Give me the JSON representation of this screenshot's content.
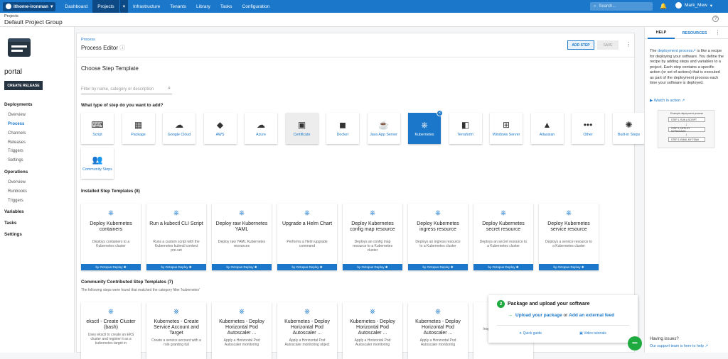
{
  "topbar": {
    "space": "ithome-ironman",
    "nav": [
      "Dashboard",
      "Projects",
      "Infrastructure",
      "Tenants",
      "Library",
      "Tasks",
      "Configuration"
    ],
    "search_placeholder": "Search...",
    "user": "Mark_Mew"
  },
  "header": {
    "breadcrumb": "Projects",
    "title": "Default Project Group"
  },
  "sidebar": {
    "project": "portal",
    "create_release": "CREATE RELEASE",
    "deployments": "Deployments",
    "dep_items": [
      "Overview",
      "Process",
      "Channels",
      "Releases",
      "Triggers",
      "Settings"
    ],
    "operations": "Operations",
    "op_items": [
      "Overview",
      "Runbooks",
      "Triggers"
    ],
    "variables": "Variables",
    "tasks": "Tasks",
    "settings": "Settings"
  },
  "editor": {
    "link": "Process",
    "title": "Process Editor",
    "add_step": "ADD STEP",
    "save": "SAVE",
    "choose": "Choose Step Template",
    "filter_placeholder": "Filter by name, category or description",
    "what_type": "What type of step do you want to add?",
    "types": [
      {
        "label": "Script",
        "icon": "script-icon",
        "glyph": "⌨"
      },
      {
        "label": "Package",
        "icon": "package-icon",
        "glyph": "▦"
      },
      {
        "label": "Google Cloud",
        "icon": "google-cloud-icon",
        "glyph": "☁"
      },
      {
        "label": "AWS",
        "icon": "aws-icon",
        "glyph": "◆"
      },
      {
        "label": "Azure",
        "icon": "azure-icon",
        "glyph": "☁"
      },
      {
        "label": "Certificate",
        "icon": "certificate-icon",
        "glyph": "▣"
      },
      {
        "label": "Docker",
        "icon": "docker-icon",
        "glyph": "◼"
      },
      {
        "label": "Java App Server",
        "icon": "java-icon",
        "glyph": "☕"
      },
      {
        "label": "Kubernetes",
        "icon": "kubernetes-icon",
        "glyph": "⎈"
      },
      {
        "label": "Terraform",
        "icon": "terraform-icon",
        "glyph": "◧"
      },
      {
        "label": "Windows Server",
        "icon": "windows-icon",
        "glyph": "⊞"
      },
      {
        "label": "Atlassian",
        "icon": "atlassian-icon",
        "glyph": "▲"
      },
      {
        "label": "Other",
        "icon": "other-icon",
        "glyph": "•••"
      },
      {
        "label": "Built-in Steps",
        "icon": "octopus-icon",
        "glyph": "✺"
      },
      {
        "label": "Community Steps",
        "icon": "community-icon",
        "glyph": "👥"
      }
    ],
    "installed_title": "Installed Step Templates (8)",
    "installed": [
      {
        "title": "Deploy Kubernetes containers",
        "desc": "Deploys containers to a Kubernetes cluster",
        "by": "by Octopus Deploy"
      },
      {
        "title": "Run a kubectl CLI Script",
        "desc": "Runs a custom script with the Kubernetes kubectl context pre-set",
        "by": "by Octopus Deploy"
      },
      {
        "title": "Deploy raw Kubernetes YAML",
        "desc": "Deploy raw YAML Kubernetes resources",
        "by": "by Octopus Deploy"
      },
      {
        "title": "Upgrade a Helm Chart",
        "desc": "Performs a Helm upgrade command",
        "by": "by Octopus Deploy"
      },
      {
        "title": "Deploy Kubernetes config map resource",
        "desc": "Deploys an config map resource to a Kubernetes cluster",
        "by": "by Octopus Deploy"
      },
      {
        "title": "Deploy Kubernetes ingress resource",
        "desc": "Deploys an ingress resource to a Kubernetes cluster",
        "by": "by Octopus Deploy"
      },
      {
        "title": "Deploy Kubernetes secret resource",
        "desc": "Deploys an secret resource to a Kubernetes cluster",
        "by": "by Octopus Deploy"
      },
      {
        "title": "Deploy Kubernetes service resource",
        "desc": "Deploys a service resource to a Kubernetes cluster",
        "by": "by Octopus Deploy"
      }
    ],
    "community_title": "Community Contributed Step Templates (7)",
    "community_sub": "The following steps were found that matched the category filter 'kubernetes'",
    "community": [
      {
        "title": "eksctl - Create Cluster (bash)",
        "desc": "Uses eksctl to create an EKS cluster and register it as a kubernetes target in"
      },
      {
        "title": "Kubernetes - Create Service Account and Target",
        "desc": "Create a service account with a role granting full"
      },
      {
        "title": "Kubernetes - Deploy Horizontal Pod Autoscaler ...",
        "desc": "Apply a Horizontal Pod Autoscaler monitoring"
      },
      {
        "title": "Kubernetes - Deploy Horizontal Pod Autoscaler ...",
        "desc": "Apply a Horizontal Pod Autoscaler monitoring object"
      },
      {
        "title": "Kubernetes - Deploy Horizontal Pod Autoscaler ...",
        "desc": "Apply a Horizontal Pod Autoscaler monitoring"
      },
      {
        "title": "Kubernetes - Deploy Horizontal Pod Autoscaler ...",
        "desc": "Apply a Horizontal Pod Autoscaler monitoring"
      },
      {
        "title": "Kube",
        "desc": "Inspe... describe and edit. Optionally"
      }
    ]
  },
  "popup": {
    "step": "2",
    "title": "Package and upload your software",
    "upload": "Upload your package",
    "or": " or ",
    "feed": "Add an external feed",
    "quick": "Quick guide",
    "video": "Video tutorials"
  },
  "help": {
    "tab_help": "HELP",
    "tab_resources": "RESOURCES",
    "the": "The ",
    "link": "deployment process",
    "text": " is like a recipe for deploying your software. You define the recipe by adding steps and variables to a project. Each step contains a specific action (or set of actions) that is executed as part of the deployment process each time your software is deployed.",
    "watch": "Watch in action",
    "example_title": "Example deployment process",
    "example_steps": [
      "STEP 1. RUN A SCRIPT",
      "STEP 2. DEPLOY MYPACKAGE",
      "STEP 3. EMAIL MY TEAM"
    ],
    "issues": "Having issues?",
    "support": "Our support team is here to help"
  },
  "colors": {
    "primary": "#1a77c9",
    "dark": "#0d4a85",
    "green": "#1eaa3e",
    "sidebar_dark": "#263340"
  }
}
